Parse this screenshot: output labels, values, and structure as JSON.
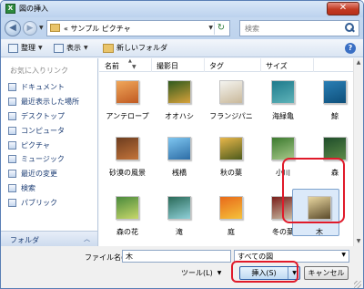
{
  "window": {
    "title": "図の挿入",
    "app_icon": "X",
    "close": "✕"
  },
  "nav": {
    "back": "◀",
    "forward": "▶"
  },
  "address": {
    "path": "« サンプル ピクチャ",
    "dropdown": "▼",
    "refresh": "↻"
  },
  "search": {
    "placeholder": "検索"
  },
  "toolbar": {
    "organize": "整理",
    "view": "表示",
    "new_folder": "新しいフォルダ",
    "help": "?"
  },
  "sidebar": {
    "header": "お気に入りリンク",
    "items": [
      {
        "label": "ドキュメント",
        "icon": "document-icon"
      },
      {
        "label": "最近表示した場所",
        "icon": "recent-places-icon"
      },
      {
        "label": "デスクトップ",
        "icon": "desktop-icon"
      },
      {
        "label": "コンピュータ",
        "icon": "computer-icon"
      },
      {
        "label": "ピクチャ",
        "icon": "pictures-icon"
      },
      {
        "label": "ミュージック",
        "icon": "music-icon"
      },
      {
        "label": "最近の変更",
        "icon": "recent-changes-icon"
      },
      {
        "label": "検索",
        "icon": "search-icon"
      },
      {
        "label": "パブリック",
        "icon": "public-folder-icon"
      }
    ],
    "folders_label": "フォルダ",
    "folders_chevron": "︿"
  },
  "columns": [
    "名前",
    "撮影日",
    "タグ",
    "サイズ"
  ],
  "files": [
    {
      "name": "アンテロープ",
      "colors": [
        "#f0a75a",
        "#c05a22"
      ]
    },
    {
      "name": "オオハシ",
      "colors": [
        "#2f5a1e",
        "#d8a23a"
      ]
    },
    {
      "name": "フランジパニ",
      "colors": [
        "#f4f4f0",
        "#c9b89a"
      ]
    },
    {
      "name": "海緑亀",
      "colors": [
        "#1e7a8c",
        "#5fb3b8"
      ]
    },
    {
      "name": "鯨",
      "colors": [
        "#2a7fb5",
        "#0e4f7a"
      ]
    },
    {
      "name": "砂漠の風景",
      "colors": [
        "#6d3d1f",
        "#c4743a"
      ]
    },
    {
      "name": "桟橋",
      "colors": [
        "#7ec6f0",
        "#2d6da6"
      ]
    },
    {
      "name": "秋の葉",
      "colors": [
        "#e8b74a",
        "#4d5b1c"
      ]
    },
    {
      "name": "小川",
      "colors": [
        "#3c7a2f",
        "#a7c98a"
      ]
    },
    {
      "name": "森",
      "colors": [
        "#1f4d2a",
        "#5c8a48"
      ]
    },
    {
      "name": "森の花",
      "colors": [
        "#4a8a3c",
        "#c8d86a"
      ]
    },
    {
      "name": "滝",
      "colors": [
        "#2a6a58",
        "#8fd0d8"
      ]
    },
    {
      "name": "庭",
      "colors": [
        "#e86a1a",
        "#f5c23a"
      ]
    },
    {
      "name": "冬の葉",
      "colors": [
        "#7a1e1a",
        "#c9c0a8"
      ]
    },
    {
      "name": "木",
      "colors": [
        "#e8d6a0",
        "#5a4a2a"
      ]
    }
  ],
  "bottom": {
    "filename_label": "ファイル名(N):",
    "filename_value": "木",
    "filetype_value": "すべての図",
    "tools_label": "ツール(L)",
    "insert_label": "挿入(S)",
    "cancel_label": "キャンセル"
  }
}
